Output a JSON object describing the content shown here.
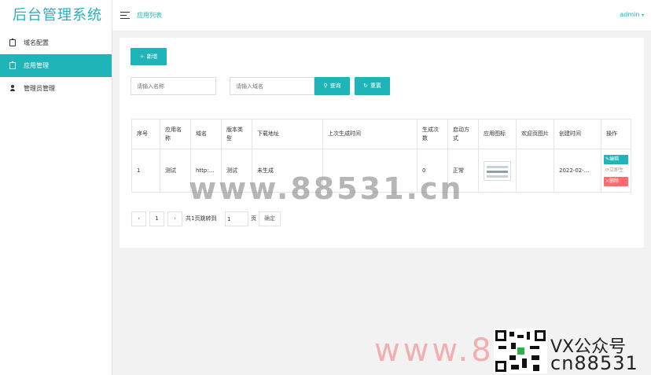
{
  "app": {
    "title": "后台管理系统"
  },
  "sidebar": {
    "items": [
      {
        "label": "域名配置",
        "icon": "clipboard-icon",
        "active": false
      },
      {
        "label": "应用管理",
        "icon": "clipboard-icon",
        "active": true
      },
      {
        "label": "管理员管理",
        "icon": "user-icon",
        "active": false
      }
    ]
  },
  "header": {
    "breadcrumb": "应用列表",
    "user": "admin"
  },
  "toolbar": {
    "add_label": "新增"
  },
  "search": {
    "name_placeholder": "请输入名称",
    "domain_placeholder": "请输入域名",
    "query_label": "查询",
    "reset_label": "重置"
  },
  "table": {
    "headers": [
      "序号",
      "应用名称",
      "域名",
      "版本类型",
      "下载地址",
      "上次生成时间",
      "生成次数",
      "启动方式",
      "应用图标",
      "欢迎页图片",
      "创建时间",
      "操作"
    ],
    "rows": [
      {
        "index": "1",
        "name": "测试",
        "domain": "http:...",
        "version": "测试",
        "download": "未生成",
        "last_gen": "",
        "gen_count": "0",
        "start_mode": "正常",
        "welcome": "",
        "created": "2022-02-...",
        "actions": {
          "edit": "编辑",
          "generate": "立即生",
          "delete": "删除"
        }
      }
    ]
  },
  "pager": {
    "prev": "‹",
    "page": "1",
    "next": "›",
    "total_text": "共1页跳转到",
    "jump_value": "1",
    "page_unit": "页",
    "confirm": "确定"
  },
  "watermark": {
    "center": "www.88531.cn",
    "bottom": "www.8",
    "wx": "VX公众号",
    "cn": "cn88531"
  },
  "colors": {
    "accent": "#1fb4b8",
    "danger": "#ff6a6a"
  }
}
